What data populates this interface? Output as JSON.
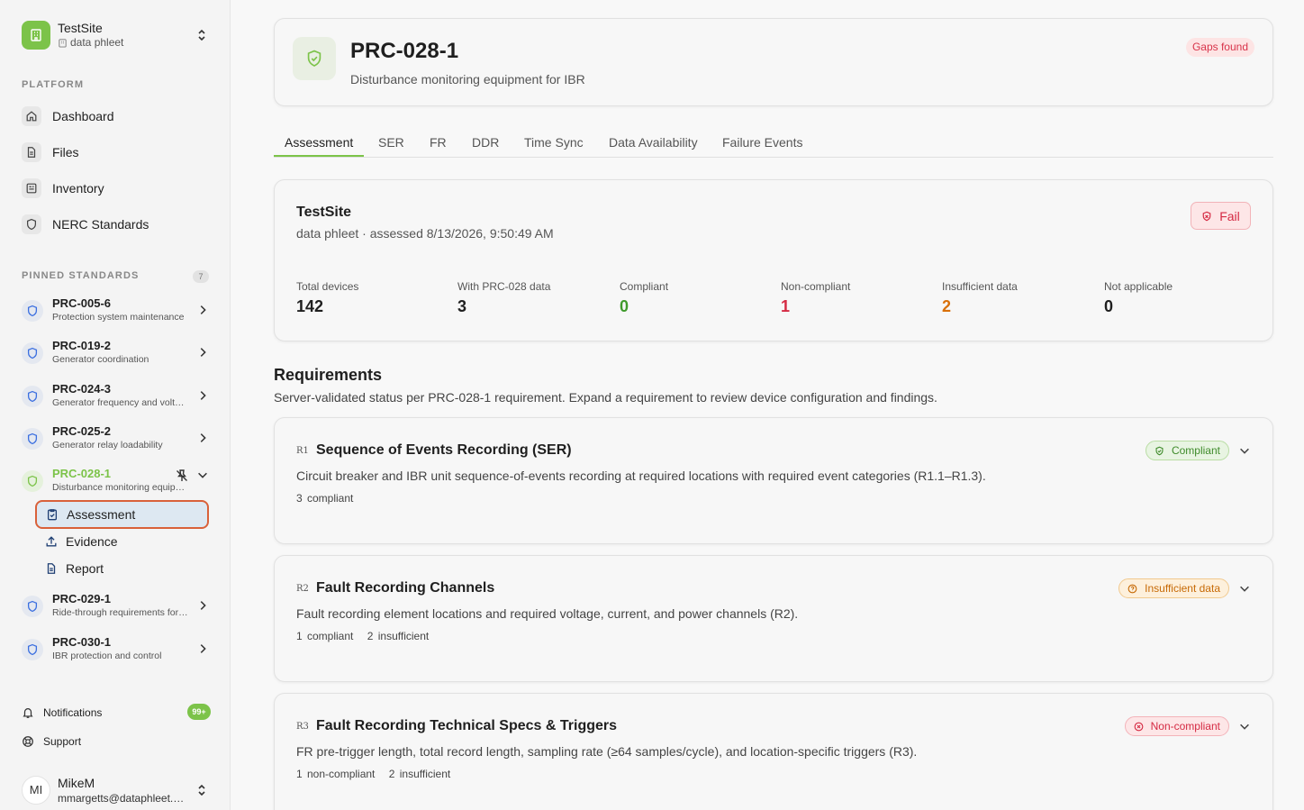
{
  "site": {
    "name": "TestSite",
    "org": "data phleet"
  },
  "sidebar": {
    "platform_title": "PLATFORM",
    "platform_items": [
      {
        "label": "Dashboard",
        "icon": "home-icon"
      },
      {
        "label": "Files",
        "icon": "file-icon"
      },
      {
        "label": "Inventory",
        "icon": "inventory-icon"
      },
      {
        "label": "NERC Standards",
        "icon": "shield-icon"
      }
    ],
    "pinned_title": "PINNED STANDARDS",
    "pinned_count": "7",
    "standards": [
      {
        "code": "PRC-005-6",
        "desc": "Protection system maintenance"
      },
      {
        "code": "PRC-019-2",
        "desc": "Generator coordination"
      },
      {
        "code": "PRC-024-3",
        "desc": "Generator frequency and voltage"
      },
      {
        "code": "PRC-025-2",
        "desc": "Generator relay loadability"
      },
      {
        "code": "PRC-028-1",
        "desc": "Disturbance monitoring equipment for IBR"
      },
      {
        "code": "PRC-029-1",
        "desc": "Ride-through requirements for IBR"
      },
      {
        "code": "PRC-030-1",
        "desc": "IBR protection and control"
      }
    ],
    "sub_items": [
      {
        "label": "Assessment",
        "icon": "clipboard-check-icon"
      },
      {
        "label": "Evidence",
        "icon": "upload-icon"
      },
      {
        "label": "Report",
        "icon": "report-icon"
      }
    ],
    "notifications_label": "Notifications",
    "notifications_badge": "99+",
    "support_label": "Support"
  },
  "user": {
    "initials": "MI",
    "name": "MikeM",
    "email": "mmargetts@dataphleet.com"
  },
  "header": {
    "title": "PRC-028-1",
    "subtitle": "Disturbance monitoring equipment for IBR",
    "badge": "Gaps found"
  },
  "tabs": [
    "Assessment",
    "SER",
    "FR",
    "DDR",
    "Time Sync",
    "Data Availability",
    "Failure Events"
  ],
  "summary": {
    "title": "TestSite",
    "subtitle": "data phleet · assessed 8/13/2026, 9:50:49 AM",
    "status": "Fail",
    "stats": [
      {
        "label": "Total devices",
        "value": "142",
        "color": "#1f1f1f"
      },
      {
        "label": "With PRC-028 data",
        "value": "3",
        "color": "#1f1f1f"
      },
      {
        "label": "Compliant",
        "value": "0",
        "color": "#3f9a2b"
      },
      {
        "label": "Non-compliant",
        "value": "1",
        "color": "#d52a43"
      },
      {
        "label": "Insufficient data",
        "value": "2",
        "color": "#d9700a"
      },
      {
        "label": "Not applicable",
        "value": "0",
        "color": "#1f1f1f"
      }
    ]
  },
  "requirements": {
    "heading": "Requirements",
    "subtitle": "Server-validated status per PRC-028-1 requirement. Expand a requirement to review device configuration and findings.",
    "items": [
      {
        "code": "R1",
        "title": "Sequence of Events Recording (SER)",
        "desc": "Circuit breaker and IBR unit sequence-of-events recording at required locations with required event categories (R1.1–R1.3).",
        "counts": [
          "3 compliant"
        ],
        "status": "Compliant"
      },
      {
        "code": "R2",
        "title": "Fault Recording Channels",
        "desc": "Fault recording element locations and required voltage, current, and power channels (R2).",
        "counts": [
          "1 compliant",
          "2 insufficient"
        ],
        "status": "Insufficient data"
      },
      {
        "code": "R3",
        "title": "Fault Recording Technical Specs & Triggers",
        "desc": "FR pre-trigger length, total record length, sampling rate (≥64 samples/cycle), and location-specific triggers (R3).",
        "counts": [
          "1 non-compliant",
          "2 insufficient"
        ],
        "status": "Non-compliant"
      }
    ]
  },
  "colors": {
    "accent": "#7cc349",
    "danger": "#d52a43",
    "warning": "#d9700a",
    "selection_border": "#d9613a"
  }
}
